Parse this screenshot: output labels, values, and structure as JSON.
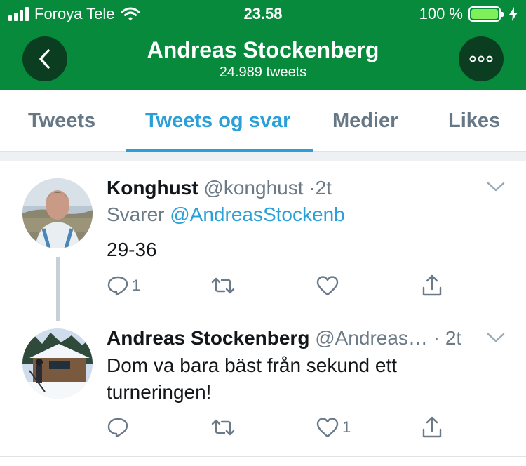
{
  "status_bar": {
    "carrier": "Foroya Tele",
    "time": "23.58",
    "battery_percent": "100 %",
    "signal_bars": 4
  },
  "profile_header": {
    "name": "Andreas Stockenberg",
    "tweet_count": "24.989 tweets",
    "back_icon": "chevron-left-icon",
    "more_icon": "more-horizontal-icon"
  },
  "tabs": [
    {
      "label": "Tweets",
      "active": false
    },
    {
      "label": "Tweets og svar",
      "active": true
    },
    {
      "label": "Medier",
      "active": false
    },
    {
      "label": "Likes",
      "active": false
    }
  ],
  "tweets": [
    {
      "name": "Konghust",
      "handle": "@konghust",
      "separator": "·",
      "time": "2t",
      "reply_prefix": "Svarer",
      "reply_to": "@AndreasStockenb",
      "text": "29-36",
      "replies": "1",
      "retweets": "",
      "likes": ""
    },
    {
      "name": "Andreas Stockenberg",
      "handle": "@Andreas…",
      "separator": "·",
      "time": "2t",
      "text_line1": "Dom va bara bäst från sekund ett",
      "text_line2": "turneringen!",
      "replies": "",
      "retweets": "",
      "likes": "1"
    }
  ],
  "colors": {
    "header_bg": "#078a3c",
    "accent": "#2a9fd8",
    "muted": "#6b7a86"
  }
}
